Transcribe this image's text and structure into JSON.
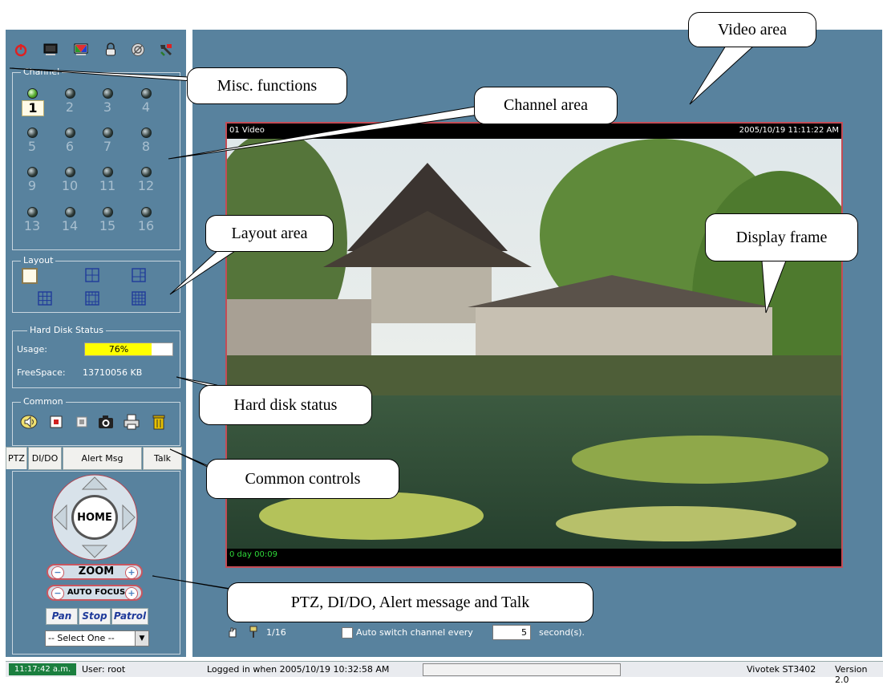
{
  "top_icons": [
    "power-icon",
    "monitor-icon",
    "color-display-icon",
    "lock-icon",
    "settings-icon",
    "tools-icon"
  ],
  "channel": {
    "title": "Channel",
    "numbers": [
      "1",
      "2",
      "3",
      "4",
      "5",
      "6",
      "7",
      "8",
      "9",
      "10",
      "11",
      "12",
      "13",
      "14",
      "15",
      "16"
    ],
    "active_index": 0
  },
  "layout": {
    "title": "Layout"
  },
  "hard_disk": {
    "title": "Hard Disk Status",
    "usage_label": "Usage:",
    "usage_value": "76%",
    "usage_fraction": 0.76,
    "freespace_label": "FreeSpace:",
    "freespace_value": "13710056 KB"
  },
  "common": {
    "title": "Common",
    "icons": [
      "speaker-icon",
      "record-icon",
      "stop-record-icon",
      "camera-snapshot-icon",
      "print-icon",
      "trash-icon"
    ]
  },
  "tabs": [
    "PTZ",
    "DI/DO",
    "Alert Msg",
    "Talk"
  ],
  "ptz": {
    "home_label": "HOME",
    "zoom_label": "ZOOM",
    "focus_label": "AUTO FOCUS",
    "pan_label": "Pan",
    "stop_label": "Stop",
    "patrol_label": "Patrol",
    "select_value": "-- Select One --",
    "minus": "−",
    "plus": "+"
  },
  "video": {
    "channel_label": "01  Video",
    "timestamp": "2005/10/19 11:11:22 AM",
    "elapsed": "0 day  00:09"
  },
  "bottom_controls": {
    "page_indicator": "1/16",
    "auto_switch_label": "Auto switch channel every",
    "auto_switch_value": "5",
    "seconds_label": "second(s)."
  },
  "statusbar": {
    "time": "11:17:42 a.m.",
    "user": "User: root",
    "logged_in": "Logged in when  2005/10/19 10:32:58 AM",
    "product": "Vivotek ST3402",
    "version": "Version 2.0"
  },
  "callouts": {
    "video_area": "Video area",
    "misc": "Misc. functions",
    "channel_area": "Channel area",
    "layout_area": "Layout area",
    "display_frame": "Display frame",
    "hard_disk": "Hard disk status",
    "common_controls": "Common controls",
    "ptz": "PTZ, DI/DO, Alert message and Talk"
  },
  "colors": {
    "panel_bg": "#58829e",
    "frame_border": "#c44c56",
    "usage_fill": "#ffff00",
    "status_time_bg": "#1b7f3f"
  }
}
